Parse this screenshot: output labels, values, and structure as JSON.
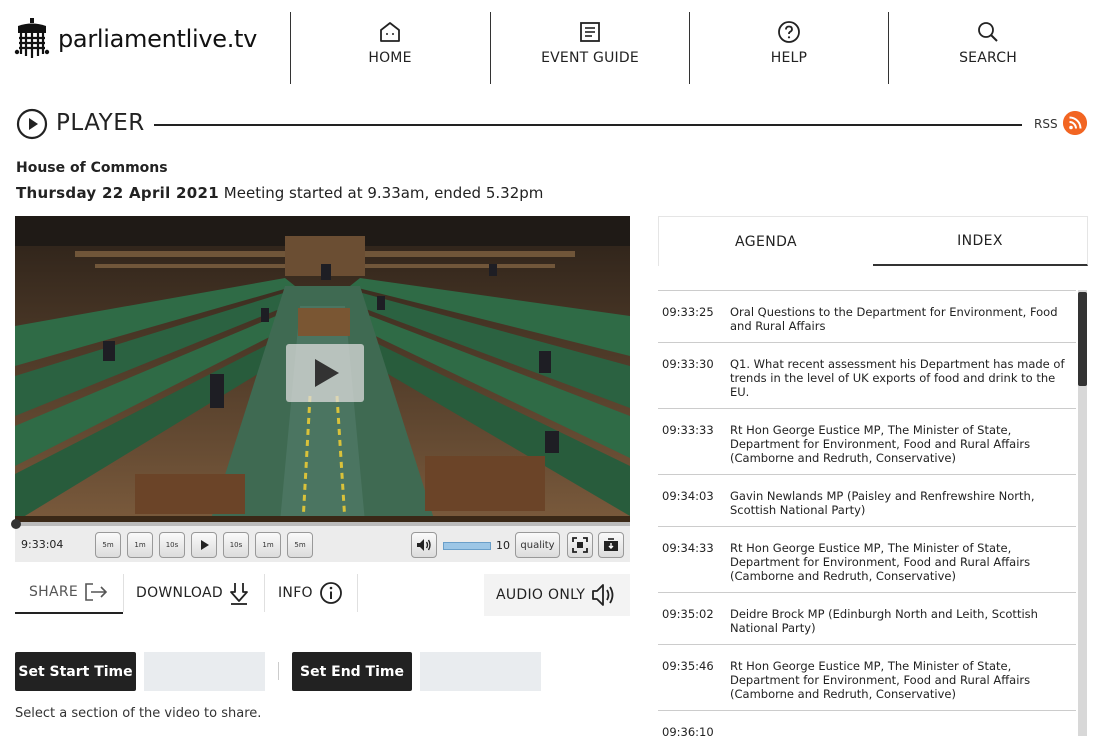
{
  "header": {
    "logo_text": "parliamentlive.tv",
    "nav": [
      {
        "label": "HOME",
        "icon": "home-icon"
      },
      {
        "label": "EVENT GUIDE",
        "icon": "document-icon"
      },
      {
        "label": "HELP",
        "icon": "help-icon"
      },
      {
        "label": "SEARCH",
        "icon": "search-icon"
      }
    ]
  },
  "player": {
    "title": "PLAYER",
    "rss_label": "RSS",
    "house": "House of Commons",
    "date": "Thursday 22 April 2021",
    "meeting": "Meeting started at 9.33am, ended 5.32pm"
  },
  "controls": {
    "timecode": "9:33:04",
    "skip_back": [
      "5m",
      "1m",
      "10s"
    ],
    "skip_forward": [
      "10s",
      "1m",
      "5m"
    ],
    "volume": "10",
    "volume_level": 1.0,
    "quality_label": "quality"
  },
  "tabs": {
    "share": "SHARE",
    "download": "DOWNLOAD",
    "info": "INFO",
    "audio_only": "AUDIO ONLY"
  },
  "share": {
    "start_label": "Set Start Time",
    "end_label": "Set End Time",
    "start_value": "",
    "end_value": "",
    "hint": "Select a section of the video to share."
  },
  "side_tabs": {
    "agenda": "AGENDA",
    "index": "INDEX"
  },
  "index": [
    {
      "time": "09:33:25",
      "text": "Oral Questions to the Department for Environment, Food and Rural Affairs"
    },
    {
      "time": "09:33:30",
      "text": "Q1. What recent assessment his Department has made of trends in the level of UK exports of food and drink to the EU."
    },
    {
      "time": "09:33:33",
      "text": "Rt Hon George Eustice MP, The Minister of State, Department for Environment, Food and Rural Affairs (Camborne and Redruth, Conservative)"
    },
    {
      "time": "09:34:03",
      "text": "Gavin Newlands MP (Paisley and Renfrewshire North, Scottish National Party)"
    },
    {
      "time": "09:34:33",
      "text": "Rt Hon George Eustice MP, The Minister of State, Department for Environment, Food and Rural Affairs (Camborne and Redruth, Conservative)"
    },
    {
      "time": "09:35:02",
      "text": "Deidre Brock MP (Edinburgh North and Leith, Scottish National Party)"
    },
    {
      "time": "09:35:46",
      "text": "Rt Hon George Eustice MP, The Minister of State, Department for Environment, Food and Rural Affairs (Camborne and Redruth, Conservative)"
    },
    {
      "time": "09:36:10",
      "text": ""
    }
  ],
  "colors": {
    "rss": "#f26522",
    "bench_green": "#2f6b46",
    "dark_button": "#222222",
    "input_bg": "#e9ecef"
  }
}
